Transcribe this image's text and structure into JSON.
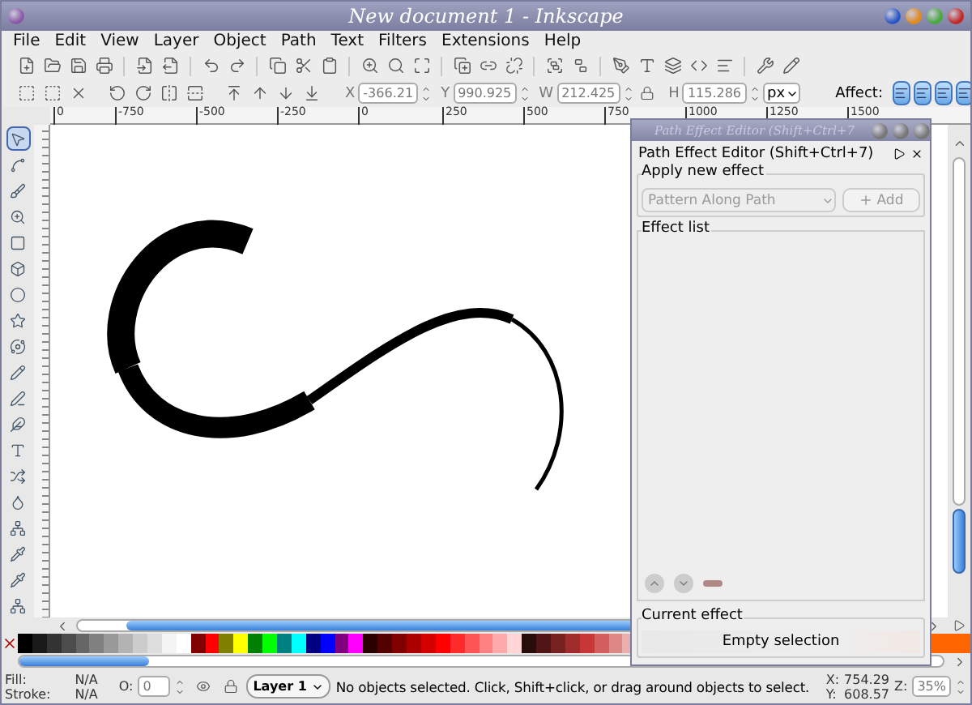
{
  "window": {
    "title": "New document 1 - Inkscape"
  },
  "menu": [
    "File",
    "Edit",
    "View",
    "Layer",
    "Object",
    "Path",
    "Text",
    "Filters",
    "Extensions",
    "Help"
  ],
  "transform_bar": {
    "fields": [
      {
        "label": "X",
        "value": "-366.21"
      },
      {
        "label": "Y",
        "value": "990.925"
      },
      {
        "label": "W",
        "value": "212.425"
      },
      {
        "label": "H",
        "value": "115.286"
      }
    ],
    "unit": "px",
    "affect_label": "Affect:",
    "affect_toggles": [
      {
        "on": true
      },
      {
        "on": true
      },
      {
        "on": true
      },
      {
        "on": true
      }
    ]
  },
  "ruler": [
    "0",
    "-750",
    "-500",
    "-250",
    "0",
    "250",
    "500",
    "750",
    "1000",
    "1250",
    "1500"
  ],
  "toolbox": [
    {
      "selected": true
    },
    {
      "selected": false
    },
    {
      "selected": false
    },
    {
      "selected": false
    },
    {
      "selected": false
    },
    {
      "selected": false
    },
    {
      "selected": false
    },
    {
      "selected": false
    },
    {
      "selected": false
    },
    {
      "selected": false
    },
    {
      "selected": false
    },
    {
      "selected": false
    },
    {
      "selected": false
    },
    {
      "selected": false
    },
    {
      "selected": false
    },
    {
      "selected": false
    },
    {
      "selected": false
    },
    {
      "selected": false
    },
    {
      "selected": false
    }
  ],
  "palette": [
    {
      "color": "#000000"
    },
    {
      "color": "#1a1a1a"
    },
    {
      "color": "#333333"
    },
    {
      "color": "#4d4d4d"
    },
    {
      "color": "#666666"
    },
    {
      "color": "#808080"
    },
    {
      "color": "#999999"
    },
    {
      "color": "#b3b3b3"
    },
    {
      "color": "#cccccc"
    },
    {
      "color": "#dddddd"
    },
    {
      "color": "#f4f4f4"
    },
    {
      "color": "#ffffff"
    },
    {
      "color": "#800000"
    },
    {
      "color": "#ff0000"
    },
    {
      "color": "#808000"
    },
    {
      "color": "#ffff00"
    },
    {
      "color": "#008000"
    },
    {
      "color": "#00ff00"
    },
    {
      "color": "#008080"
    },
    {
      "color": "#00ffff"
    },
    {
      "color": "#000080"
    },
    {
      "color": "#0000ff"
    },
    {
      "color": "#800080"
    },
    {
      "color": "#ff00ff"
    },
    {
      "color": "#2b0000"
    },
    {
      "color": "#550000"
    },
    {
      "color": "#800000"
    },
    {
      "color": "#aa0000"
    },
    {
      "color": "#d40000"
    },
    {
      "color": "#ff0000"
    },
    {
      "color": "#ff2a2a"
    },
    {
      "color": "#ff5555"
    },
    {
      "color": "#ff8080"
    },
    {
      "color": "#ffaaaa"
    },
    {
      "color": "#ffd5d5"
    },
    {
      "color": "#280b0b"
    },
    {
      "color": "#501616"
    },
    {
      "color": "#782121"
    },
    {
      "color": "#a02c2c"
    },
    {
      "color": "#c83737"
    },
    {
      "color": "#d35f5f"
    },
    {
      "color": "#de8787"
    },
    {
      "color": "#e9afaf"
    }
  ],
  "palette_right": [
    {
      "color": "#ff6600"
    }
  ],
  "status_bar": {
    "fill_label": "Fill:",
    "fill_value": "N/A",
    "stroke_label": "Stroke:",
    "stroke_value": "N/A",
    "opacity_label": "O:",
    "opacity_value": "0",
    "layer": "Layer 1",
    "message": "No objects selected. Click, Shift+click, or drag around objects to select.",
    "x_label": "X:",
    "x_value": "754.29",
    "y_label": "Y:",
    "y_value": "608.57",
    "zoom_label": "Z:",
    "zoom_value": "35%"
  },
  "dialog": {
    "window_title": "Path Effect Editor (Shift+Ctrl+7",
    "title": "Path Effect Editor (Shift+Ctrl+7)",
    "apply_label": "Apply new effect",
    "effect_select": "Pattern Along Path",
    "add_button": {
      "label": "Add",
      "disabled": true
    },
    "effect_list_label": "Effect list",
    "current_effect_label": "Current effect",
    "current_effect_value": "Empty selection"
  }
}
